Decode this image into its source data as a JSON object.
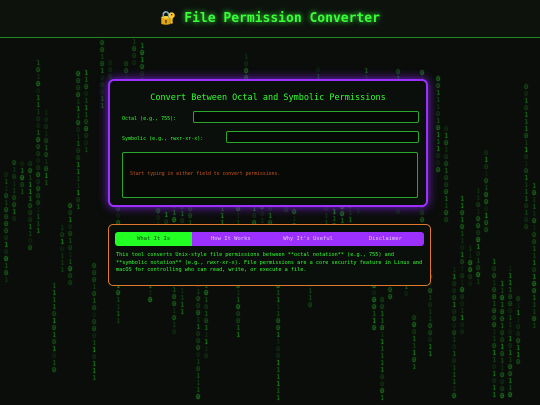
{
  "header": {
    "title": "File Permission Converter",
    "icon": "lock-icon"
  },
  "converter": {
    "title": "Convert Between Octal and Symbolic Permissions",
    "octal_label": "Octal (e.g., 755):",
    "octal_value": "",
    "symbolic_label": "Symbolic (e.g., rwxr-xr-x):",
    "symbolic_value": "",
    "output_text": "Start typing in either field to convert permissions."
  },
  "info": {
    "tabs": [
      {
        "label": "What It Is",
        "active": true
      },
      {
        "label": "How It Works",
        "active": false
      },
      {
        "label": "Why It's Useful",
        "active": false
      },
      {
        "label": "Disclaimer",
        "active": false
      }
    ],
    "text": "This tool converts Unix-style file permissions between **octal notation** (e.g., 755) and **symbolic notation** (e.g., rwxr-xr-x). File permissions are a core security feature in Linux and macOS for controlling who can read, write, or execute a file."
  },
  "colors": {
    "accent_green": "#33ff33",
    "accent_purple": "#9b30ff",
    "accent_orange": "#e07a2a",
    "background": "#0a0d0a"
  }
}
